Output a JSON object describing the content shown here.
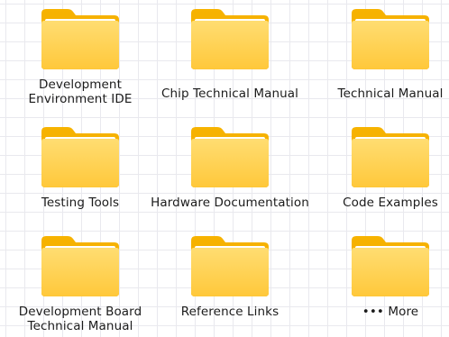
{
  "folders": [
    {
      "label": "Development\nEnvironment IDE",
      "icon": "folder-icon"
    },
    {
      "label": "Chip Technical Manual",
      "icon": "folder-icon"
    },
    {
      "label": "Technical Manual",
      "icon": "folder-icon"
    },
    {
      "label": "Testing Tools",
      "icon": "folder-icon"
    },
    {
      "label": "Hardware Documentation",
      "icon": "folder-icon"
    },
    {
      "label": "Code Examples",
      "icon": "folder-icon"
    },
    {
      "label": "Development Board\nTechnical Manual",
      "icon": "folder-icon"
    },
    {
      "label": "Reference Links",
      "icon": "folder-icon"
    },
    {
      "label": "••• More",
      "icon": "folder-icon"
    }
  ],
  "colors": {
    "folder_back": "#F6B400",
    "folder_front": "#FFD35C",
    "folder_paper": "#FFFFFF",
    "grid_line": "#E9E9EE",
    "label_text": "#1B1B1B"
  }
}
